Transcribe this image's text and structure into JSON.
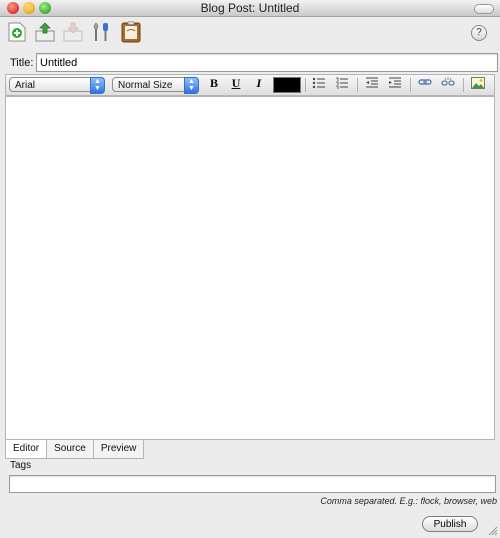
{
  "window": {
    "title": "Blog Post: Untitled"
  },
  "toolbar": {
    "icons": [
      "new-post-icon",
      "upload-icon",
      "download-icon",
      "settings-icon",
      "clipboard-icon"
    ],
    "help_label": "?"
  },
  "post": {
    "title_label": "Title:",
    "title_value": "Untitled"
  },
  "format": {
    "font": "Arial",
    "size": "Normal Size",
    "bold": "B",
    "underline": "U",
    "italic": "I",
    "text_color": "#000000"
  },
  "tabs": [
    {
      "label": "Editor",
      "active": true
    },
    {
      "label": "Source",
      "active": false
    },
    {
      "label": "Preview",
      "active": false
    }
  ],
  "tags": {
    "label": "Tags",
    "value": "",
    "hint": "Comma separated. E.g.: flock, browser, web"
  },
  "publish_label": "Publish"
}
